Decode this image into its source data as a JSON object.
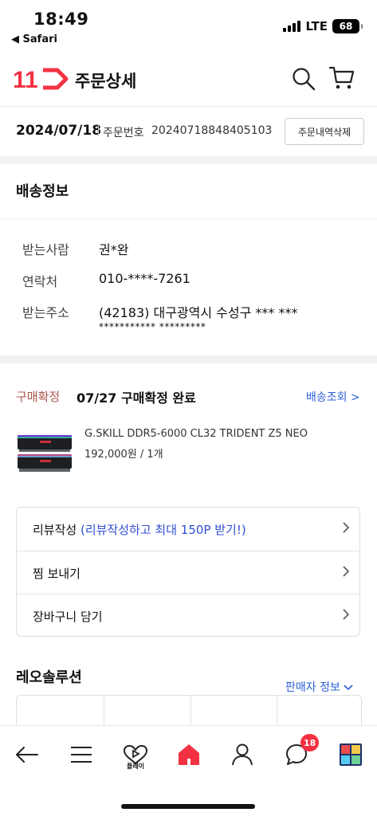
{
  "status_bar": {
    "time": "18:49",
    "back_app": "◀ Safari",
    "network": "LTE",
    "battery": "68"
  },
  "header": {
    "logo_text": "11",
    "title": "주문상세"
  },
  "order": {
    "date": "2024/07/18",
    "number_label": "주문번호",
    "number": "20240718848405103",
    "delete_button": "주문내역삭제"
  },
  "shipping": {
    "title": "배송정보",
    "recipient_label": "받는사람",
    "recipient": "권*완",
    "contact_label": "연락처",
    "contact": "010-****-7261",
    "address_label": "받는주소",
    "address_line1": "(42183) 대구광역시 수성구 *** ***",
    "address_line2": "*********** *********"
  },
  "purchase": {
    "status_label": "구매확정",
    "status_text": "07/27 구매확정 완료",
    "track_link": "배송조회 >",
    "product_name": "G.SKILL DDR5-6000 CL32 TRIDENT Z5 NEO",
    "product_price": "192,000원 / 1개"
  },
  "actions": {
    "review": "리뷰작성",
    "review_hint": "(리뷰작성하고 최대 150P 받기!)",
    "wish": "찜 보내기",
    "cart": "장바구니 담기"
  },
  "seller": {
    "name": "레오솔루션",
    "info_link": "판매자 정보"
  },
  "bottom_nav": {
    "play_label": "플레이",
    "chat_badge": "18"
  },
  "colors": {
    "brand": "#f43142",
    "link": "#2f62d8",
    "confirm": "#a8574b"
  }
}
